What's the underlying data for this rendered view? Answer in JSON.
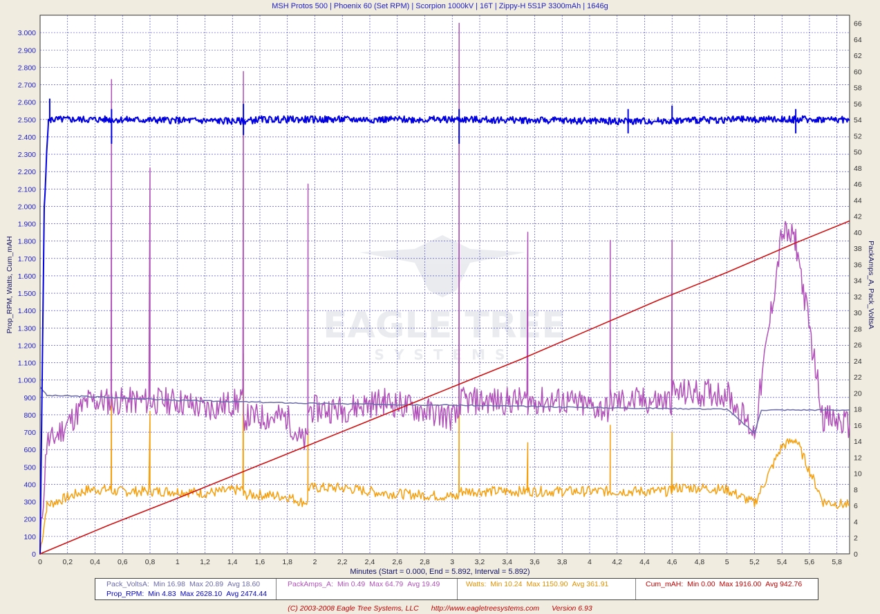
{
  "title": "MSH Protos 500 | Phoenix 60 (Set RPM) | Scorpion 1000kV | 16T | Zippy-H 5S1P 3300mAh | 1646g",
  "watermark": {
    "line1": "EAGLE TREE",
    "line2": "SYSTEMS"
  },
  "x_axis_label": "Minutes (Start = 0.000,  End = 5.892,  Interval = 5.892)",
  "legend": {
    "pack_volts": {
      "name": "Pack_VoltsA:",
      "min": "Min 16.98",
      "max": "Max 20.89",
      "avg": "Avg 18.60",
      "color": "#6a6aaa"
    },
    "prop_rpm": {
      "name": "Prop_RPM:",
      "min": "Min 4.83",
      "max": "Max 2628.10",
      "avg": "Avg 2474.44",
      "color": "#0000e0"
    },
    "pack_amps": {
      "name": "PackAmps_A:",
      "min": "Min 0.49",
      "max": "Max 64.79",
      "avg": "Avg 19.49",
      "color": "#b050b8"
    },
    "watts": {
      "name": "Watts:",
      "min": "Min 10.24",
      "max": "Max 1150.90",
      "avg": "Avg 361.91",
      "color": "#f5a010"
    },
    "cum_mah": {
      "name": "Cum_mAH:",
      "min": "Min 0.00",
      "max": "Max 1916.00",
      "avg": "Avg 942.76",
      "color": "#d01010"
    }
  },
  "footer": {
    "copyright": "(C) 2003-2008 Eagle Tree Systems, LLC",
    "url": "http://www.eagletreesystems.com",
    "version": "Version 6.93"
  },
  "chart_data": {
    "type": "line",
    "title": "MSH Protos 500 | Phoenix 60 (Set RPM) | Scorpion 1000kV | 16T | Zippy-H 5S1P 3300mAh | 1646g",
    "xlabel": "Minutes (Start = 0.000,  End = 5.892,  Interval = 5.892)",
    "ylabel_left": "Prop_RPM, Watts, Cum_mAH",
    "ylabel_right": "PackAmps_A, Pack_VoltsA",
    "xlim": [
      0,
      5.892
    ],
    "ylim_left": [
      0,
      3.1
    ],
    "ylim_right": [
      0,
      67
    ],
    "x_ticks": [
      "0",
      "0,2",
      "0,4",
      "0,6",
      "0,8",
      "1",
      "1,2",
      "1,4",
      "1,6",
      "1,8",
      "2",
      "2,2",
      "2,4",
      "2,6",
      "2,8",
      "3",
      "3,2",
      "3,4",
      "3,6",
      "3,8",
      "4",
      "4,2",
      "4,4",
      "4,6",
      "4,8",
      "5",
      "5,2",
      "5,4",
      "5,6",
      "5,8"
    ],
    "y_left_ticks": [
      "0",
      "100",
      "200",
      "300",
      "400",
      "500",
      "600",
      "700",
      "800",
      "900",
      "1.000",
      "1.100",
      "1.200",
      "1.300",
      "1.400",
      "1.500",
      "1.600",
      "1.700",
      "1.800",
      "1.900",
      "2.000",
      "2.100",
      "2.200",
      "2.300",
      "2.400",
      "2.500",
      "2.600",
      "2.700",
      "2.800",
      "2.900",
      "3.000"
    ],
    "y_right_ticks": [
      "0",
      "2",
      "4",
      "6",
      "8",
      "10",
      "12",
      "14",
      "16",
      "18",
      "20",
      "22",
      "24",
      "26",
      "28",
      "30",
      "32",
      "34",
      "36",
      "38",
      "40",
      "42",
      "44",
      "46",
      "48",
      "50",
      "52",
      "54",
      "56",
      "58",
      "60",
      "62",
      "64",
      "66"
    ],
    "grid": true,
    "series": [
      {
        "name": "Prop_RPM",
        "axis": "left",
        "color": "#0000e0",
        "x": [
          0,
          0.03,
          0.06,
          0.08,
          0.1,
          0.5,
          1.48,
          1.6,
          3.0,
          3.05,
          4.3,
          5.1,
          5.892
        ],
        "y": [
          0,
          2000,
          2490,
          2500,
          2500,
          2500,
          2490,
          2500,
          2500,
          2500,
          2490,
          2500,
          2500
        ],
        "spikes": [
          [
            0.07,
            2620
          ],
          [
            0.52,
            2560
          ],
          [
            0.52,
            2360
          ],
          [
            1.48,
            2590
          ],
          [
            1.48,
            2410
          ],
          [
            3.05,
            2560
          ],
          [
            3.05,
            2360
          ],
          [
            4.28,
            2560
          ],
          [
            4.28,
            2420
          ],
          [
            4.6,
            2580
          ],
          [
            5.5,
            2560
          ],
          [
            5.5,
            2420
          ]
        ]
      },
      {
        "name": "Pack_VoltsA",
        "axis": "right",
        "color": "#6a6aaa",
        "x": [
          0,
          0.05,
          0.3,
          1.0,
          2.0,
          3.0,
          4.0,
          5.0,
          5.2,
          5.25,
          5.3,
          5.892
        ],
        "y": [
          20.8,
          19.7,
          19.6,
          19.1,
          18.7,
          18.5,
          18.2,
          18.0,
          15.0,
          17.9,
          17.9,
          17.9
        ]
      },
      {
        "name": "PackAmps_A",
        "axis": "right",
        "color": "#b050b8",
        "x": [
          0,
          0.05,
          0.08,
          0.35,
          0.5,
          0.52,
          0.6,
          0.8,
          0.82,
          1.0,
          1.2,
          1.46,
          1.48,
          1.6,
          1.8,
          1.9,
          1.95,
          2.2,
          2.5,
          3.0,
          3.05,
          3.1,
          3.4,
          3.55,
          3.8,
          4.1,
          4.15,
          4.5,
          4.6,
          4.8,
          5.0,
          5.2,
          5.4,
          5.5,
          5.7,
          5.892
        ],
        "y": [
          1,
          14,
          14,
          19,
          19,
          59,
          19,
          48,
          19,
          19,
          18,
          19,
          60,
          17,
          17,
          14,
          46,
          18,
          19,
          17,
          66,
          19,
          19,
          40,
          19,
          18,
          39,
          19,
          39,
          20,
          20,
          15,
          40,
          39,
          17,
          16
        ]
      },
      {
        "name": "Watts",
        "axis": "left",
        "color": "#f5a010",
        "x": [
          0,
          0.05,
          0.08,
          0.35,
          0.5,
          0.52,
          0.6,
          0.8,
          0.82,
          1.0,
          1.2,
          1.46,
          1.48,
          1.6,
          1.8,
          1.9,
          1.95,
          2.2,
          2.5,
          3.0,
          3.05,
          3.1,
          3.4,
          3.55,
          3.8,
          4.1,
          4.15,
          4.5,
          4.6,
          4.8,
          5.0,
          5.2,
          5.4,
          5.5,
          5.7,
          5.892
        ],
        "y": [
          10,
          280,
          290,
          370,
          370,
          1040,
          360,
          820,
          360,
          360,
          350,
          370,
          1150,
          340,
          330,
          300,
          720,
          380,
          350,
          330,
          1150,
          360,
          360,
          640,
          360,
          360,
          740,
          360,
          700,
          380,
          370,
          290,
          620,
          660,
          300,
          280
        ]
      },
      {
        "name": "Cum_mAH",
        "axis": "left",
        "color": "#d01010",
        "x": [
          0,
          0.5,
          1.0,
          1.5,
          2.0,
          2.5,
          3.0,
          3.5,
          4.0,
          4.5,
          5.0,
          5.5,
          5.892
        ],
        "y": [
          0,
          165,
          320,
          480,
          640,
          800,
          960,
          1120,
          1290,
          1460,
          1620,
          1790,
          1916
        ]
      }
    ]
  }
}
